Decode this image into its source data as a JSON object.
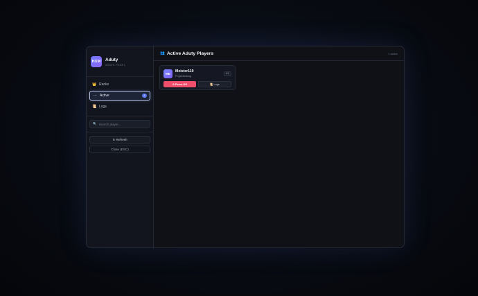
{
  "brand": {
    "logo_text": "HXM",
    "title": "Aduty",
    "subtitle": "ADMIN PANEL"
  },
  "nav": [
    {
      "label": "Ranks",
      "icon": "crown-icon",
      "glyph": "👑"
    },
    {
      "label": "Active",
      "icon": "dots-icon",
      "glyph": "⋯",
      "badge": "1"
    },
    {
      "label": "Logs",
      "icon": "scroll-icon",
      "glyph": "📜"
    }
  ],
  "search": {
    "placeholder": "Search player..."
  },
  "actions": {
    "refresh": "↻ Refresh",
    "close": "Close (ESC)"
  },
  "main": {
    "title": "Active Aduty Players",
    "title_glyph": "👥",
    "count": "1 active"
  },
  "players": [
    {
      "initials": "ME",
      "name": "Meister119",
      "role": "Projektleitung",
      "id": "#1",
      "force_off": "⊘ Force-Off",
      "logs": "📜 Logs"
    }
  ],
  "colors": {
    "accent": "#5e78f0",
    "danger": "#ef4f6c",
    "logo": "#6f7bff"
  }
}
